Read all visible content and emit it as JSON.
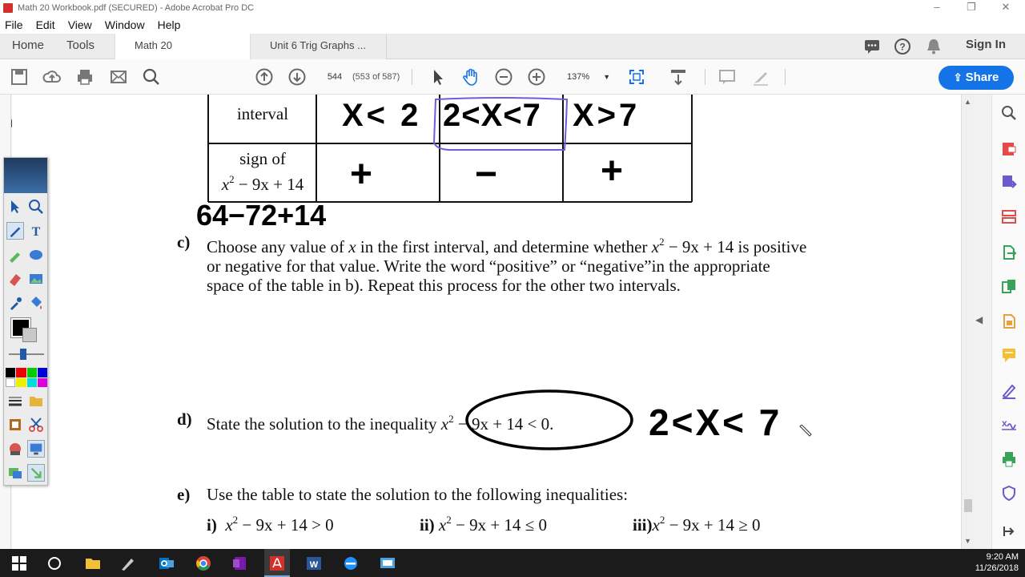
{
  "window": {
    "title": "Math 20 Workbook.pdf (SECURED) - Adobe Acrobat Pro DC",
    "minimize": "‒",
    "restore": "❐",
    "close": "✕"
  },
  "menu": [
    "File",
    "Edit",
    "View",
    "Window",
    "Help"
  ],
  "tabs": {
    "home": "Home",
    "tools": "Tools",
    "active_doc": "Math 20 Workbook...",
    "close_glyph": "×",
    "inactive_doc": "Unit 6 Trig Graphs ..."
  },
  "header": {
    "sign_in": "Sign In",
    "share": "Share"
  },
  "toolbar": {
    "page_number": "544",
    "page_count": "(553 of 587)",
    "zoom": "137%"
  },
  "document": {
    "table": {
      "row1_label": "interval",
      "row2_label_line1": "sign of",
      "row2_label_line2_prefix": "x",
      "row2_label_line2_exp": "2",
      "row2_label_line2_rest": " − 9x + 14"
    },
    "part_c": {
      "label": "c)",
      "line1_a": "Choose any value of ",
      "line1_var": "x",
      "line1_b": " in the first interval, and determine whether ",
      "line1_var2": "x",
      "line1_exp": "2",
      "line1_c": " − 9x + 14  is positive",
      "line2": "or negative for that value.  Write the word “positive” or “negative”in the appropriate",
      "line3": "space of the table in b).  Repeat this process for the other two intervals."
    },
    "part_d": {
      "label": "d)",
      "text": "State the solution to the inequality ",
      "expr_var": "x",
      "expr_exp": "2",
      "expr_rest": " − 9x + 14 < 0."
    },
    "part_e": {
      "label": "e)",
      "text": "Use the table to state the solution to the following inequalities:",
      "items": [
        {
          "label": "i)",
          "var": "x",
          "exp": "2",
          "rest": " − 9x + 14 > 0"
        },
        {
          "label": "ii)",
          "var": "x",
          "exp": "2",
          "rest": " − 9x + 14 ≤ 0"
        },
        {
          "label": "iii)",
          "var": "x",
          "exp": "2",
          "rest": " − 9x + 14 ≥ 0"
        }
      ]
    },
    "handwriting": {
      "interval1": "X< 2",
      "interval2": "2<X<7",
      "interval3": "X>7",
      "sign1": "+",
      "sign2": "−",
      "sign3": "+",
      "scratch": "64−72+14",
      "answer": "2<X< 7"
    }
  },
  "taskbar": {
    "time": "9:20 AM",
    "date": "11/26/2018"
  },
  "colors": {
    "accent": "#1473e6",
    "adobe_red": "#d4302b",
    "highlight": "#6b5ce0"
  }
}
